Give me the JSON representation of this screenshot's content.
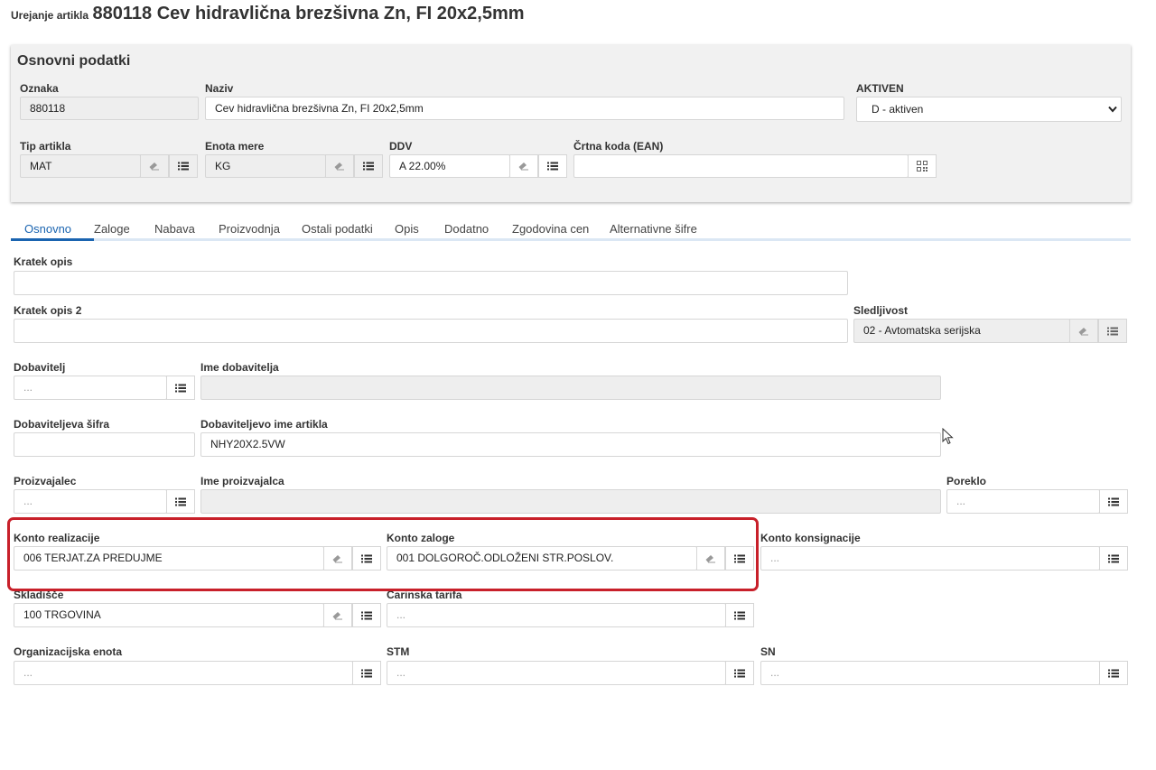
{
  "header": {
    "prefix": "Urejanje artikla",
    "title": "880118 Cev hidravlična brezšivna Zn, FI 20x2,5mm"
  },
  "basic_panel": {
    "title": "Osnovni podatki",
    "oznaka": {
      "label": "Oznaka",
      "value": "880118"
    },
    "naziv": {
      "label": "Naziv",
      "value": "Cev hidravlična brezšivna Zn, FI 20x2,5mm"
    },
    "aktiven": {
      "label": "AKTIVEN",
      "value": "D - aktiven"
    },
    "tip_artikla": {
      "label": "Tip artikla",
      "value": "MAT"
    },
    "enota_mere": {
      "label": "Enota mere",
      "value": "KG"
    },
    "ddv": {
      "label": "DDV",
      "value": "A 22.00%"
    },
    "ean": {
      "label": "Črtna koda (EAN)",
      "value": ""
    }
  },
  "tabs": [
    "Osnovno",
    "Zaloge",
    "Nabava",
    "Proizvodnja",
    "Ostali podatki",
    "Opis",
    "Dodatno",
    "Zgodovina cen",
    "Alternativne šifre"
  ],
  "form": {
    "kratek_opis": {
      "label": "Kratek opis",
      "value": ""
    },
    "kratek_opis2": {
      "label": "Kratek opis 2",
      "value": ""
    },
    "sledljivost": {
      "label": "Sledljivost",
      "value": "02 - Avtomatska serijska"
    },
    "dobavitelj": {
      "label": "Dobavitelj",
      "placeholder": "..."
    },
    "ime_dobavitelja": {
      "label": "Ime dobavitelja",
      "value": ""
    },
    "dobaviteljeva_sifra": {
      "label": "Dobaviteljeva šifra",
      "value": ""
    },
    "dobaviteljevo_ime": {
      "label": "Dobaviteljevo ime artikla",
      "value": "NHY20X2.5VW"
    },
    "proizvajalec": {
      "label": "Proizvajalec",
      "placeholder": "..."
    },
    "ime_proizvajalca": {
      "label": "Ime proizvajalca",
      "value": ""
    },
    "poreklo": {
      "label": "Poreklo",
      "placeholder": "..."
    },
    "konto_realizacije": {
      "label": "Konto realizacije",
      "value": "006 TERJAT.ZA PREDUJME"
    },
    "konto_zaloge": {
      "label": "Konto zaloge",
      "value": "001 DOLGOROČ.ODLOŽENI STR.POSLOV."
    },
    "konto_konsignacije": {
      "label": "Konto konsignacije",
      "placeholder": "..."
    },
    "skladisce": {
      "label": "Skladišče",
      "value": "100 TRGOVINA"
    },
    "carinska_tarifa": {
      "label": "Carinska tarifa",
      "placeholder": "..."
    },
    "org_enota": {
      "label": "Organizacijska enota",
      "placeholder": "..."
    },
    "stm": {
      "label": "STM",
      "placeholder": "..."
    },
    "sn": {
      "label": "SN",
      "placeholder": "..."
    }
  },
  "icons": {
    "list": "list-icon",
    "clear": "eraser-icon",
    "qr": "qr-code-icon"
  }
}
